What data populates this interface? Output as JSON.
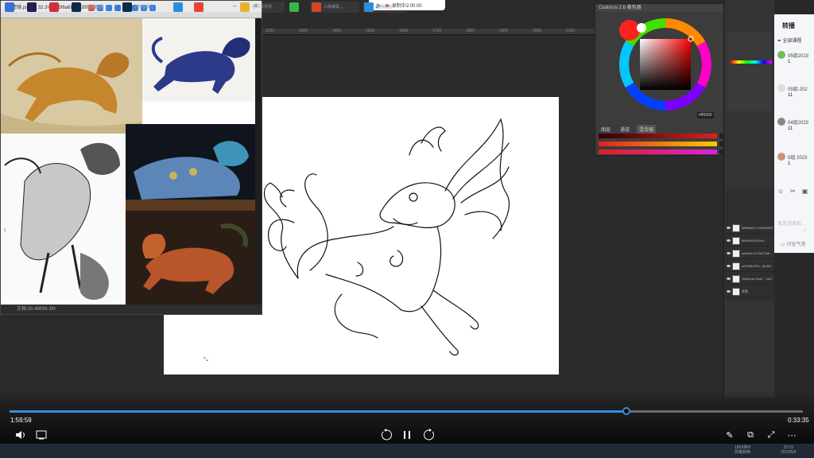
{
  "recording": {
    "label": "录制中2:00:00"
  },
  "reference_window": {
    "title": "滤镜.psd @ 32.3% (5f5f6a6877e38f3e8f...",
    "status": "文档:20.4M/56.3M"
  },
  "color_picker": {
    "title": "Coolorus 2.6 着色器",
    "tabs": [
      "图层",
      "通道",
      "混合器"
    ],
    "active_tab": "混合器",
    "sliders": [
      {
        "label": "R",
        "value": "255",
        "color": "#e02020"
      },
      {
        "label": "G",
        "value": "0",
        "color": "#ff7a00"
      },
      {
        "label": "B",
        "value": "0",
        "color": "#e020e0"
      }
    ],
    "hex": "#ff0000",
    "fg_color": "#ff2020",
    "bg_color": "#ffffff"
  },
  "layers": [
    {
      "name": "5f5f6a6877e38f3e8f07..."
    },
    {
      "name": "8e84f4d2591ed..."
    },
    {
      "name": "a0894e1c17b872e6..."
    },
    {
      "name": "d87d96c9f7c...8e4ff7...."
    },
    {
      "name": "Toshiyuki Inuki - Tu87... (5)"
    },
    {
      "name": "背景"
    }
  ],
  "chat": {
    "header": "转播",
    "all_courses": "全部课程",
    "items": [
      {
        "name": "05组2023",
        "count": "1"
      },
      {
        "name": "05组-202",
        "count": "11"
      },
      {
        "name": "04组2023",
        "count": "11"
      },
      {
        "name": "5组 2023",
        "count": "1"
      }
    ],
    "input_placeholder": "发送消息给...",
    "bubble_label": "讨论气泡"
  },
  "player": {
    "current_time": "1:59:59",
    "remaining_time": "0:33:35",
    "progress": 0.778,
    "rewind_label": "10",
    "forward_label": "30"
  },
  "taskbar": {
    "apps": [
      {
        "name": "start",
        "label": "",
        "color": "#3a6fd8"
      },
      {
        "name": "after-effects",
        "label": "",
        "color": "#2a1b55"
      },
      {
        "name": "netease",
        "label": "",
        "color": "#d0303a"
      },
      {
        "name": "photoshop-1",
        "label": "作品编辑器...",
        "color": "#0c2a4a"
      },
      {
        "name": "photoshop-2",
        "label": "人物模板...",
        "color": "#0c2a4a"
      },
      {
        "name": "browser",
        "label": "",
        "color": "#2a8ee0"
      },
      {
        "name": "chrome",
        "label": "",
        "color": "#ea4335"
      },
      {
        "name": "folder",
        "label": "已共享文件",
        "color": "#e8b230"
      },
      {
        "name": "wechat",
        "label": "",
        "color": "#3ab54a"
      },
      {
        "name": "powerpoint",
        "label": "人体速写...",
        "color": "#d24726"
      },
      {
        "name": "player",
        "label": "直播教室",
        "color": "#2a8ee0"
      }
    ],
    "tray_line1": "1869排/0",
    "tray_line2": "风格转换",
    "clock_time": "22:02",
    "clock_date": "2023/5/5"
  },
  "ruler_ticks": [
    "1200",
    "1300",
    "1400",
    "1500",
    "1600",
    "1700",
    "1800",
    "1900",
    "2000",
    "2100",
    "2200",
    "2300",
    "2400",
    "2500"
  ]
}
